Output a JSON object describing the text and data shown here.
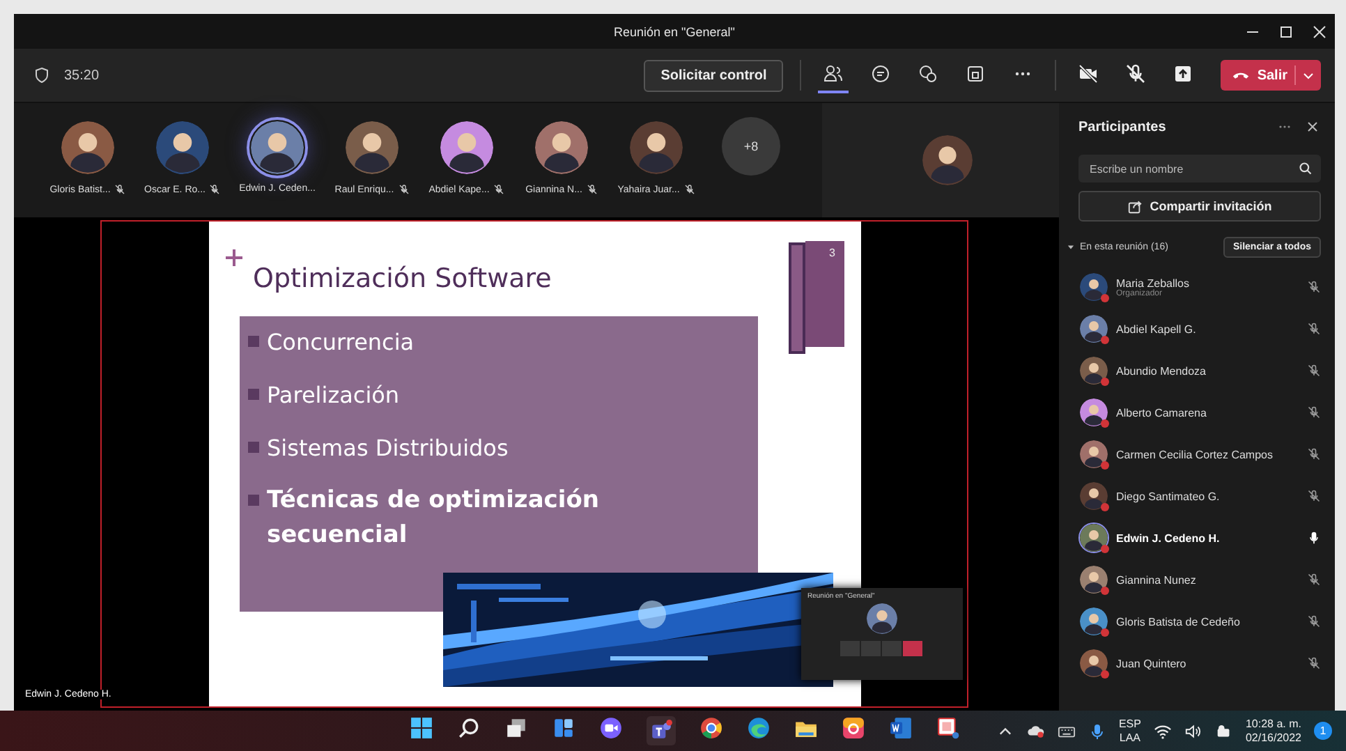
{
  "window": {
    "title": "Reunión en \"General\""
  },
  "toolbar": {
    "timer": "35:20",
    "request_control": "Solicitar control",
    "leave": "Salir",
    "people_selected": true
  },
  "strip": {
    "participants": [
      {
        "name": "Gloris Batist...",
        "muted": true,
        "selected": false
      },
      {
        "name": "Oscar E. Ro...",
        "muted": true,
        "selected": false
      },
      {
        "name": "Edwin J. Ceden...",
        "muted": false,
        "selected": true
      },
      {
        "name": "Raul Enriqu...",
        "muted": true,
        "selected": false
      },
      {
        "name": "Abdiel Kape...",
        "muted": true,
        "selected": false
      },
      {
        "name": "Giannina N...",
        "muted": true,
        "selected": false
      },
      {
        "name": "Yahaira Juar...",
        "muted": true,
        "selected": false
      }
    ],
    "overflow": "+8"
  },
  "stage": {
    "presenter": "Edwin J. Cedeno H.",
    "slide": {
      "title": "Optimización Software",
      "page_number": "3",
      "bullets": [
        {
          "text": "Concurrencia",
          "bold": false
        },
        {
          "text": "Parelización",
          "bold": false
        },
        {
          "text": "Sistemas Distribuidos",
          "bold": false
        },
        {
          "text": "Técnicas de optimización secuencial",
          "bold": true
        }
      ]
    },
    "mini_window": {
      "title": "Reunión en \"General\""
    }
  },
  "panel": {
    "title": "Participantes",
    "search": {
      "placeholder": "Escribe un nombre"
    },
    "share": "Compartir invitación",
    "section": {
      "label": "En esta reunión (16)",
      "expanded": true
    },
    "mute_all": "Silenciar a todos",
    "participants": [
      {
        "name": "Maria Zeballos",
        "role": "Organizador",
        "muted": true,
        "speaking": false
      },
      {
        "name": "Abdiel Kapell G.",
        "muted": true,
        "speaking": false
      },
      {
        "name": "Abundio Mendoza",
        "muted": true,
        "speaking": false
      },
      {
        "name": "Alberto Camarena",
        "muted": true,
        "speaking": false
      },
      {
        "name": "Carmen Cecilia Cortez Campos",
        "muted": true,
        "speaking": false
      },
      {
        "name": "Diego Santimateo G.",
        "muted": true,
        "speaking": false
      },
      {
        "name": "Edwin J. Cedeno H.",
        "muted": false,
        "speaking": true
      },
      {
        "name": "Giannina Nunez",
        "muted": true,
        "speaking": false
      },
      {
        "name": "Gloris Batista de Cedeño",
        "muted": true,
        "speaking": false
      },
      {
        "name": "Juan Quintero",
        "muted": true,
        "speaking": false
      }
    ]
  },
  "taskbar": {
    "language": "ESP",
    "layout": "LAA",
    "time": "10:28 a. m.",
    "date": "02/16/2022",
    "notifications": "1"
  }
}
